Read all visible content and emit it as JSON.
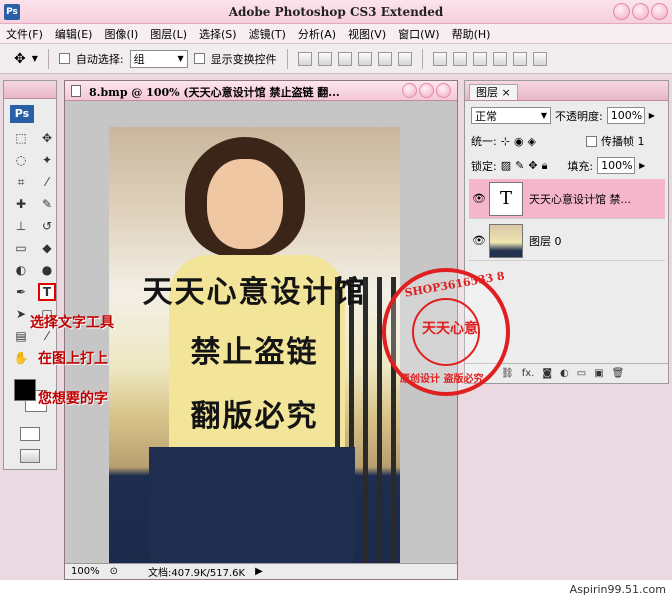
{
  "app": {
    "title": "Adobe Photoshop CS3 Extended",
    "logo": "Ps"
  },
  "menu": [
    "文件(F)",
    "编辑(E)",
    "图像(I)",
    "图层(L)",
    "选择(S)",
    "滤镜(T)",
    "分析(A)",
    "视图(V)",
    "窗口(W)",
    "帮助(H)"
  ],
  "options": {
    "auto_select_label": "自动选择:",
    "auto_select_value": "组",
    "show_transform_label": "显示变换控件"
  },
  "document": {
    "tab_title": "8.bmp @ 100% (天天心意设计馆 禁止盗链 翻...",
    "zoom": "100%",
    "doc_size": "文档:407.9K/517.6K",
    "lines": [
      "天天心意设计馆",
      "禁止盗链",
      "翻版必究"
    ]
  },
  "layers_panel": {
    "tab_label": "图层",
    "blend_mode": "正常",
    "opacity_label": "不透明度:",
    "opacity_value": "100%",
    "unify_label": "统一:",
    "propagate_label": "传播帧 1",
    "lock_label": "锁定:",
    "fill_label": "填充:",
    "fill_value": "100%",
    "layers": [
      {
        "thumb": "T",
        "name": "天天心意设计馆 禁..."
      },
      {
        "thumb": "",
        "name": "图层 0"
      }
    ],
    "footer_label": "fx."
  },
  "toolbox": {
    "type_tool_glyph": "T"
  },
  "annotations": [
    "选择文字工具",
    "在图上打上",
    "您想要的字"
  ],
  "stamp": {
    "outer_text": "SHOP3616533 8",
    "center_text": "天天心意",
    "bottom_text": "原创设计 盗版必究"
  },
  "watermark": "Aspirin99.51.com",
  "colors": {
    "accent_pink": "#f4c7d7",
    "annotation_red": "#c00000",
    "stamp_red": "#e02020"
  }
}
